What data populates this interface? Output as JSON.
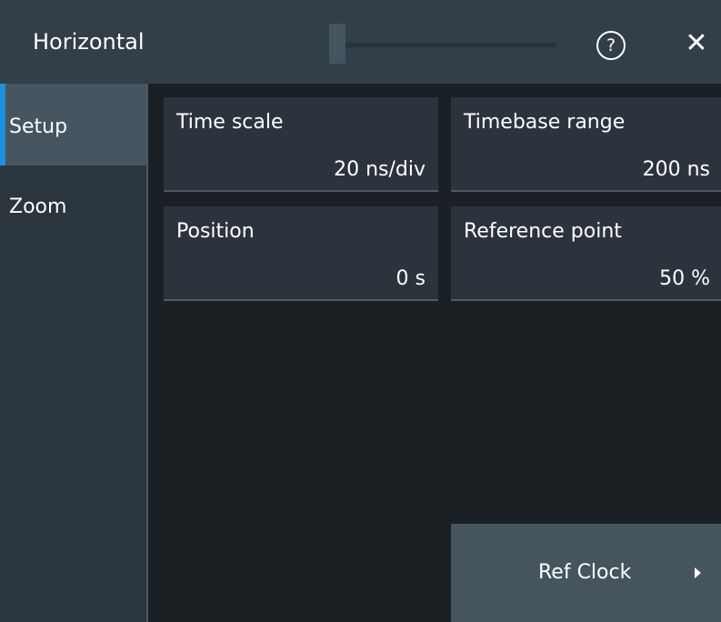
{
  "dialog": {
    "title": "Horizontal",
    "help_icon_glyph": "?",
    "close_icon_glyph": "✕",
    "accent_color": "#1e90e0"
  },
  "sidebar": {
    "tabs": [
      {
        "label": "Setup",
        "selected": true
      },
      {
        "label": "Zoom",
        "selected": false
      }
    ]
  },
  "fields": {
    "time_scale": {
      "label": "Time scale",
      "value": "20 ns/div"
    },
    "timebase_range": {
      "label": "Timebase range",
      "value": "200 ns"
    },
    "position": {
      "label": "Position",
      "value": "0 s"
    },
    "reference_point": {
      "label": "Reference point",
      "value": "50 %"
    }
  },
  "ref_clock_button": {
    "label": "Ref Clock"
  }
}
